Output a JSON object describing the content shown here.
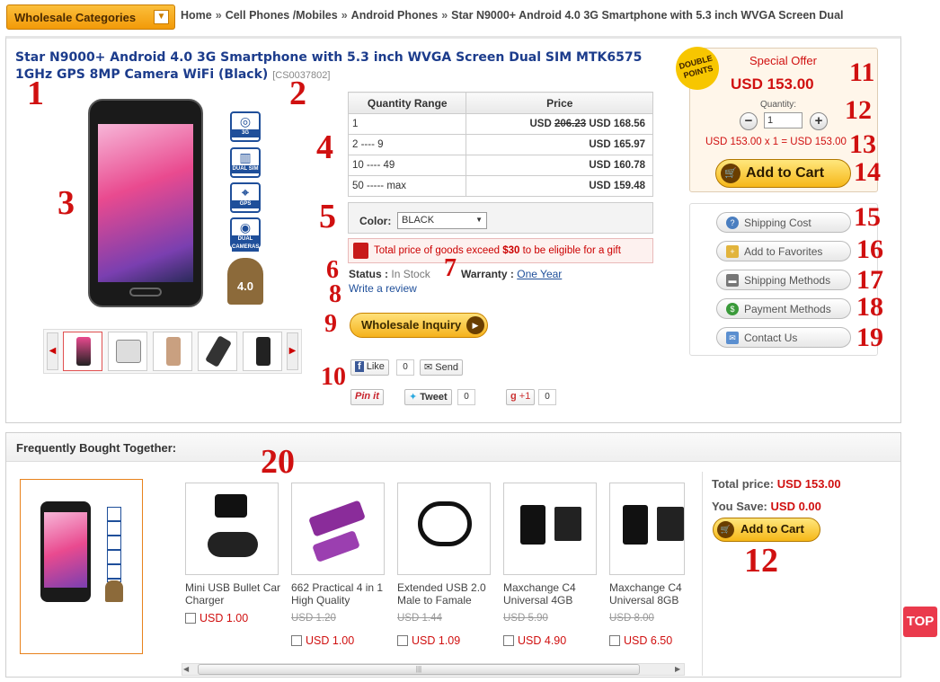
{
  "nav": {
    "categories_button": "Wholesale Categories",
    "breadcrumb": [
      "Home",
      "Cell Phones /Mobiles",
      "Android Phones",
      "Star N9000+ Android 4.0 3G Smartphone with 5.3 inch WVGA Screen Dual"
    ],
    "breadcrumb_sep": "»"
  },
  "product": {
    "title": "Star N9000+ Android 4.0 3G Smartphone with 5.3 inch WVGA Screen Dual SIM MTK6575 1GHz GPS 8MP Camera WiFi (Black)",
    "sku": "[CS0037802]",
    "features": [
      {
        "icon": "3g-icon",
        "label": "3G"
      },
      {
        "icon": "dual-sim-icon",
        "label": "DUAL SIM"
      },
      {
        "icon": "gps-icon",
        "label": "GPS"
      },
      {
        "icon": "dual-camera-icon",
        "label": "DUAL CAMERAS"
      }
    ],
    "android_version": "4.0"
  },
  "price_table": {
    "headers": [
      "Quantity Range",
      "Price"
    ],
    "rows": [
      {
        "range": "1",
        "old": "206.23",
        "price": "USD 168.56",
        "currency": "USD"
      },
      {
        "range": "2 ---- 9",
        "price": "USD 165.97"
      },
      {
        "range": "10 ---- 49",
        "price": "USD 160.78"
      },
      {
        "range": "50 ----- max",
        "price": "USD 159.48"
      }
    ]
  },
  "options": {
    "color_label": "Color:",
    "color_value": "BLACK",
    "gift_text_1": "Total price of goods exceed ",
    "gift_amount": "$30",
    "gift_text_2": " to be eligible for a gift",
    "status_label": "Status :",
    "status_value": "In Stock",
    "warranty_label": "Warranty :",
    "warranty_value": "One Year",
    "review_link": "Write a review",
    "wholesale_button": "Wholesale Inquiry"
  },
  "social": {
    "like": "Like",
    "like_count": "0",
    "send": "Send",
    "pinit": "Pin it",
    "tweet": "Tweet",
    "tweet_count": "0",
    "gplus": "+1",
    "gplus_count": "0"
  },
  "offer": {
    "badge": "DOUBLE POINTS",
    "title": "Special Offer",
    "price": "USD 153.00",
    "qty_label": "Quantity:",
    "qty_value": "1",
    "calc": "USD 153.00 x 1 = USD 153.00",
    "add_to_cart": "Add to Cart"
  },
  "links": [
    "Shipping Cost",
    "Add to Favorites",
    "Shipping Methods",
    "Payment Methods",
    "Contact Us"
  ],
  "fbt": {
    "title": "Frequently Bought Together:",
    "products": [
      {
        "name": "Mini USB Bullet Car Charger",
        "old": "",
        "price": "USD 1.00"
      },
      {
        "name": "662 Practical 4 in 1 High Quality",
        "old": "USD 1.20",
        "price": "USD 1.00"
      },
      {
        "name": "Extended USB 2.0 Male to Famale",
        "old": "USD 1.44",
        "price": "USD 1.09"
      },
      {
        "name": "Maxchange C4 Universal 4GB",
        "old": "USD 5.90",
        "price": "USD 4.90"
      },
      {
        "name": "Maxchange C4 Universal 8GB",
        "old": "USD 8.00",
        "price": "USD 6.50"
      }
    ],
    "total_label": "Total price:",
    "total_value": "USD 153.00",
    "save_label": "You Save:",
    "save_value": "USD 0.00",
    "add_to_cart": "Add to Cart"
  },
  "annotations": [
    "1",
    "2",
    "3",
    "4",
    "5",
    "6",
    "7",
    "8",
    "9",
    "10",
    "11",
    "12",
    "13",
    "14",
    "15",
    "16",
    "17",
    "18",
    "19",
    "20",
    "12"
  ],
  "top_button": "TOP",
  "colors": {
    "accent": "#f6b718",
    "price_red": "#d01010",
    "link_blue": "#1f4f9a"
  }
}
